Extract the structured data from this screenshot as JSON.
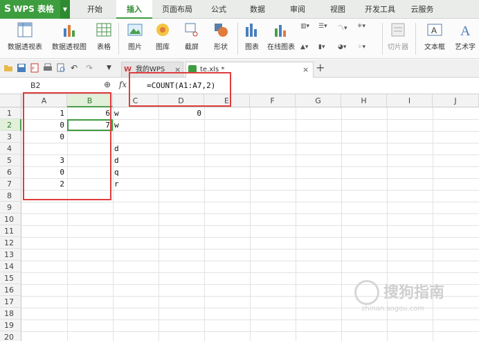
{
  "app": {
    "logo_text": "WPS 表格",
    "logo_s": "S"
  },
  "menu": {
    "items": [
      "开始",
      "插入",
      "页面布局",
      "公式",
      "数据",
      "审阅",
      "视图",
      "开发工具",
      "云服务"
    ],
    "active": "插入"
  },
  "ribbon": {
    "buttons": [
      "数据透视表",
      "数据透视图",
      "表格",
      "图片",
      "图库",
      "截屏",
      "形状",
      "图表",
      "在线图表",
      "切片器",
      "文本框",
      "艺术字"
    ]
  },
  "tabs": {
    "tab1": "我的WPS",
    "tab2": "te.xls *"
  },
  "formula_bar": {
    "name_box": "B2",
    "fx": "fx",
    "formula": "=COUNT(A1:A7,2)"
  },
  "grid": {
    "columns": [
      "A",
      "B",
      "C",
      "D",
      "E",
      "F",
      "G",
      "H",
      "I",
      "J"
    ],
    "selected_column": "B",
    "rows": [
      "1",
      "2",
      "3",
      "4",
      "5",
      "6",
      "7",
      "8",
      "9",
      "10",
      "11",
      "12",
      "13",
      "14",
      "15",
      "16",
      "17",
      "18",
      "19",
      "20"
    ],
    "selected_row": "2",
    "cells": {
      "A1": "1",
      "B1": "6",
      "C1": "w",
      "D1": "0",
      "A2": "0",
      "B2": "7",
      "C2": "w",
      "A3": "0",
      "C4": "d",
      "A5": "3",
      "C5": "d",
      "A6": "0",
      "C6": "q",
      "A7": "2",
      "C7": "r"
    }
  },
  "watermark": {
    "text": "搜狗指南",
    "url": "zhinan.sogou.com"
  },
  "colors": {
    "accent": "#3e9d3f",
    "annotation": "#e03b3b"
  }
}
